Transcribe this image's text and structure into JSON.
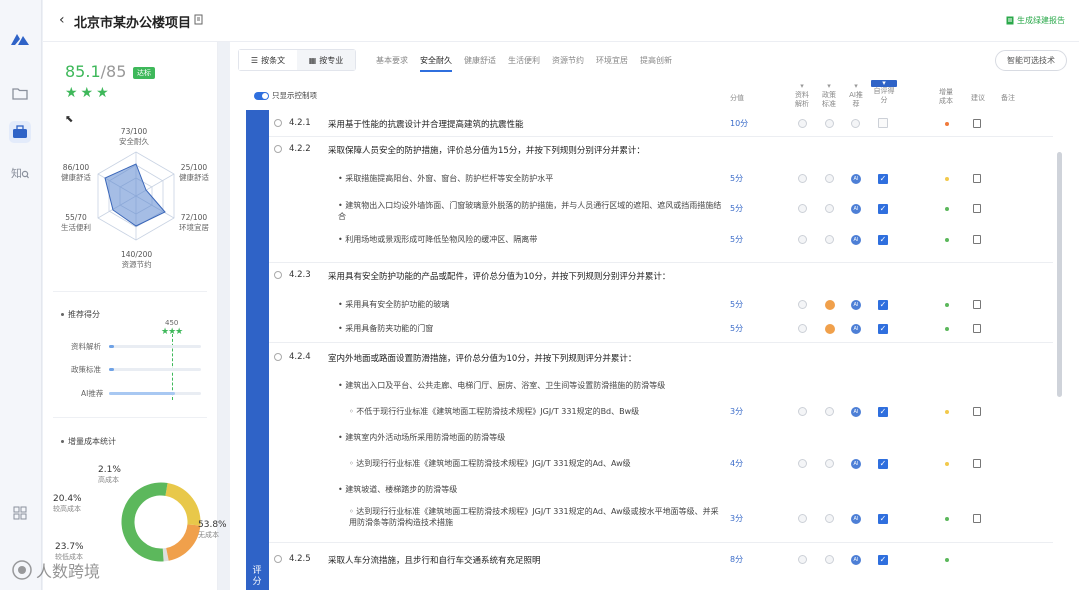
{
  "header": {
    "back_icon": "chevron-left-icon",
    "title": "北京市某办公楼项目",
    "generate": "生成绿建报告"
  },
  "rail": {
    "icons": [
      "logo-icon",
      "folder-icon",
      "briefcase-icon",
      "knowledge-icon",
      "grid-icon"
    ]
  },
  "summary": {
    "score": "85.1",
    "total": "/85",
    "badge": "达标",
    "stars": "★★★",
    "radar": [
      {
        "value": "73/100",
        "label": "安全耐久"
      },
      {
        "value": "25/100",
        "label": "健康舒适"
      },
      {
        "value": "72/100",
        "label": "环境宜居"
      },
      {
        "value": "140/200",
        "label": "资源节约"
      },
      {
        "value": "55/70",
        "label": "生活便利"
      },
      {
        "value": "86/100",
        "label": "健康舒适"
      }
    ],
    "recommend": {
      "title": "推荐得分",
      "marker": "450",
      "bars": [
        {
          "label": "资料解析",
          "fill": 0.05
        },
        {
          "label": "政策标准",
          "fill": 0.05
        },
        {
          "label": "AI推荐",
          "fill": 0.72
        }
      ]
    },
    "cost": {
      "title": "增量成本统计",
      "segments": [
        {
          "pct": "53.8%",
          "label": "无成本",
          "color": "#5cb85c",
          "share": 0.538
        },
        {
          "pct": "23.7%",
          "label": "较低成本",
          "color": "#e8c84a",
          "share": 0.237
        },
        {
          "pct": "20.4%",
          "label": "较高成本",
          "color": "#f0a04b",
          "share": 0.204
        },
        {
          "pct": "2.1%",
          "label": "高成本",
          "color": "#dedede",
          "share": 0.021
        }
      ]
    }
  },
  "main": {
    "view_tabs": [
      "按条文",
      "按专业"
    ],
    "categories": [
      "基本要求",
      "安全耐久",
      "健康舒适",
      "生活便利",
      "资源节约",
      "环境宜居",
      "提高创新"
    ],
    "active_category": "安全耐久",
    "right_button": "智能可选技术",
    "toggle_label": "只显示控制项",
    "cols": {
      "score": "分值",
      "doc": "资料解析",
      "policy": "政策标准",
      "ai": "AI推荐",
      "self": "自评得分",
      "cost": "增量成本",
      "advice": "建议",
      "remark": "备注"
    },
    "side_label": "评分",
    "rows": [
      {
        "code": "4.2.1",
        "text": "采用基于性能的抗震设计并合理提高建筑的抗震性能",
        "score": "10分"
      },
      {
        "code": "4.2.2",
        "text": "采取保障人员安全的防护措施，评价总分值为15分，并按下列规则分别评分并累计："
      },
      {
        "text": "• 采取措施提高阳台、外窗、窗台、防护栏杆等安全防护水平",
        "score": "5分"
      },
      {
        "text": "• 建筑物出入口均设外墙饰面、门窗玻璃意外脱落的防护措施，并与人员通行区域的遮阳、遮风或挡雨措施结合",
        "score": "5分"
      },
      {
        "text": "• 利用场地或景观形成可降低坠物风险的缓冲区、隔离带",
        "score": "5分"
      },
      {
        "code": "4.2.3",
        "text": "采用具有安全防护功能的产品或配件，评价总分值为10分，并按下列规则分别评分并累计："
      },
      {
        "text": "• 采用具有安全防护功能的玻璃",
        "score": "5分"
      },
      {
        "text": "• 采用具备防夹功能的门窗",
        "score": "5分"
      },
      {
        "code": "4.2.4",
        "text": "室内外地面或路面设置防滑措施，评价总分值为10分，并按下列规则评分并累计："
      },
      {
        "text": "• 建筑出入口及平台、公共走廊、电梯门厅、厨房、浴室、卫生间等设置防滑措施的防滑等级"
      },
      {
        "text": "◦ 不低于现行行业标准《建筑地面工程防滑技术规程》JGJ/T 331规定的Bd、Bw级",
        "score": "3分"
      },
      {
        "text": "• 建筑室内外活动场所采用防滑地面的防滑等级"
      },
      {
        "text": "◦ 达到现行行业标准《建筑地面工程防滑技术规程》JGJ/T 331规定的Ad、Aw级",
        "score": "4分"
      },
      {
        "text": "• 建筑坡道、楼梯踏步的防滑等级"
      },
      {
        "text": "◦ 达到现行行业标准《建筑地面工程防滑技术规程》JGJ/T 331规定的Ad、Aw级或按水平地面等级、并采用防滑条等防滑构造技术措施",
        "score": "3分"
      },
      {
        "code": "4.2.5",
        "text": "采取人车分流措施，且步行和自行车交通系统有充足照明",
        "score": "8分"
      }
    ]
  },
  "watermark": "人数跨境"
}
